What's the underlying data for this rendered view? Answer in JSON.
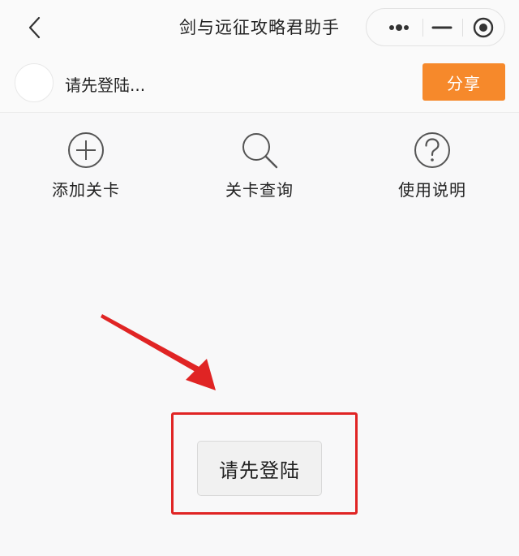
{
  "navbar": {
    "title": "剑与远征攻略君助手",
    "back_icon": "chevron-left-icon",
    "capsule": {
      "more_icon": "more-dots-icon",
      "minimize_icon": "minimize-icon",
      "close_icon": "target-close-icon"
    }
  },
  "user": {
    "name": "请先登陆...",
    "share_label": "分享",
    "share_color": "#f6892b"
  },
  "actions": [
    {
      "label": "添加关卡",
      "icon": "plus-circle-icon"
    },
    {
      "label": "关卡查询",
      "icon": "search-icon"
    },
    {
      "label": "使用说明",
      "icon": "help-circle-icon"
    }
  ],
  "login": {
    "button_label": "请先登陆",
    "highlight_color": "#e02424"
  }
}
